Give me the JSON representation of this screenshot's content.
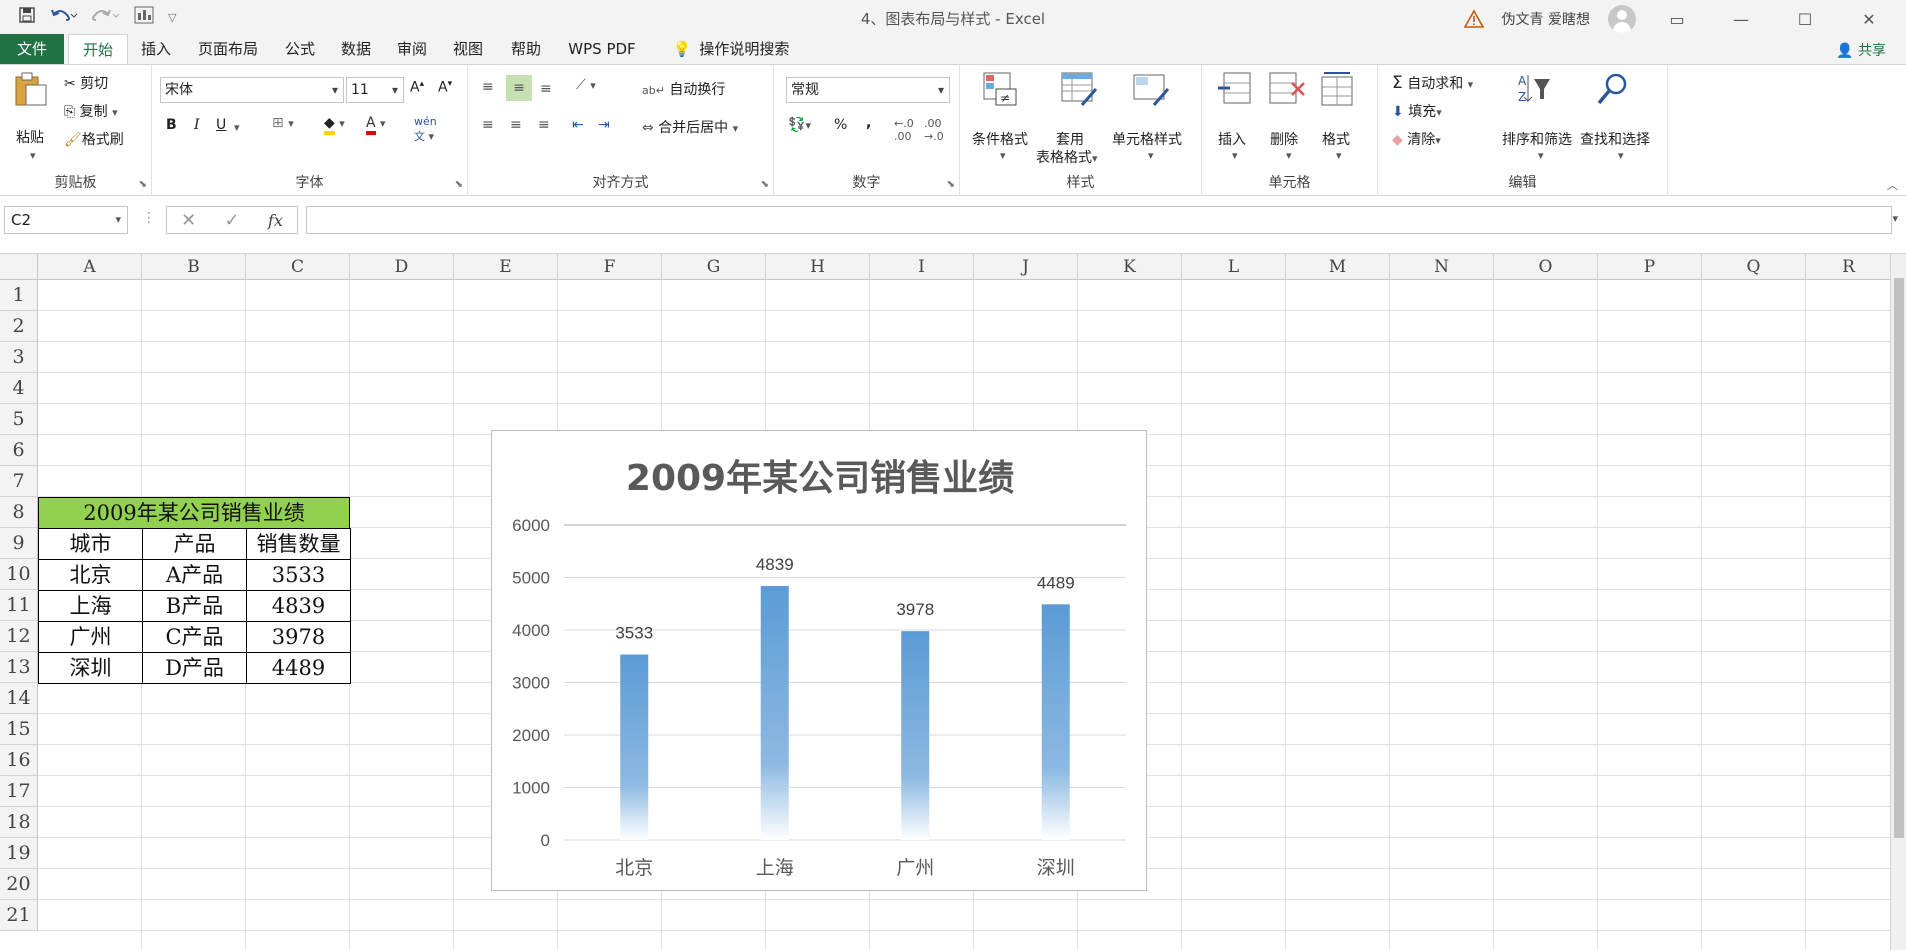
{
  "title_bar": {
    "document_title": "4、图表布局与样式 - Excel",
    "user_name": "伪文青 爱瞎想",
    "qat_icons": [
      "save-icon",
      "undo-icon",
      "redo-icon",
      "print-preview-icon",
      "customize-icon"
    ]
  },
  "tabs": [
    "文件",
    "开始",
    "插入",
    "页面布局",
    "公式",
    "数据",
    "审阅",
    "视图",
    "帮助",
    "WPS PDF",
    "操作说明搜索"
  ],
  "share_label": "共享",
  "ribbon": {
    "clipboard": {
      "paste": "粘贴",
      "cut": "剪切",
      "copy": "复制",
      "format_painter": "格式刷",
      "label": "剪贴板"
    },
    "font": {
      "font_name": "宋体",
      "font_size": "11",
      "bold": "B",
      "italic": "I",
      "underline": "U",
      "label": "字体"
    },
    "alignment": {
      "wrap": "自动换行",
      "merge": "合并后居中",
      "label": "对齐方式"
    },
    "number": {
      "format": "常规",
      "percent": "%",
      "comma": ",",
      "label": "数字"
    },
    "styles": {
      "conditional": "条件格式",
      "table_format_1": "套用",
      "table_format_2": "表格格式",
      "cell_styles": "单元格样式",
      "label": "样式"
    },
    "cells": {
      "insert": "插入",
      "delete": "删除",
      "format": "格式",
      "label": "单元格"
    },
    "editing": {
      "autosum": "自动求和",
      "fill": "填充",
      "clear": "清除",
      "sort": "排序和筛选",
      "find": "查找和选择",
      "label": "编辑"
    }
  },
  "formula_bar": {
    "name_box": "C2",
    "cancel": "✕",
    "enter": "✓",
    "fx": "fx",
    "value": ""
  },
  "columns": [
    "A",
    "B",
    "C",
    "D",
    "E",
    "F",
    "G",
    "H",
    "I",
    "J",
    "K",
    "L",
    "M",
    "N",
    "O",
    "P",
    "Q",
    "R"
  ],
  "rows": [
    "1",
    "2",
    "3",
    "4",
    "5",
    "6",
    "7",
    "8",
    "9",
    "10",
    "11",
    "12",
    "13",
    "14",
    "15",
    "16",
    "17",
    "18",
    "19",
    "20",
    "21"
  ],
  "table": {
    "title": "2009年某公司销售业绩",
    "headers": [
      "城市",
      "产品",
      "销售数量"
    ],
    "rows": [
      [
        "北京",
        "A产品",
        "3533"
      ],
      [
        "上海",
        "B产品",
        "4839"
      ],
      [
        "广州",
        "C产品",
        "3978"
      ],
      [
        "深圳",
        "D产品",
        "4489"
      ]
    ]
  },
  "colors": {
    "accent": "#217346",
    "title_fill": "#92d050",
    "bar": "#5b9bd5"
  },
  "chart_data": {
    "type": "bar",
    "title": "2009年某公司销售业绩",
    "categories": [
      "北京",
      "上海",
      "广州",
      "深圳"
    ],
    "values": [
      3533,
      4839,
      3978,
      4489
    ],
    "ylim": [
      0,
      6000
    ],
    "yticks": [
      0,
      1000,
      2000,
      3000,
      4000,
      5000,
      6000
    ],
    "grid": true,
    "legend": "none",
    "data_labels": true
  }
}
